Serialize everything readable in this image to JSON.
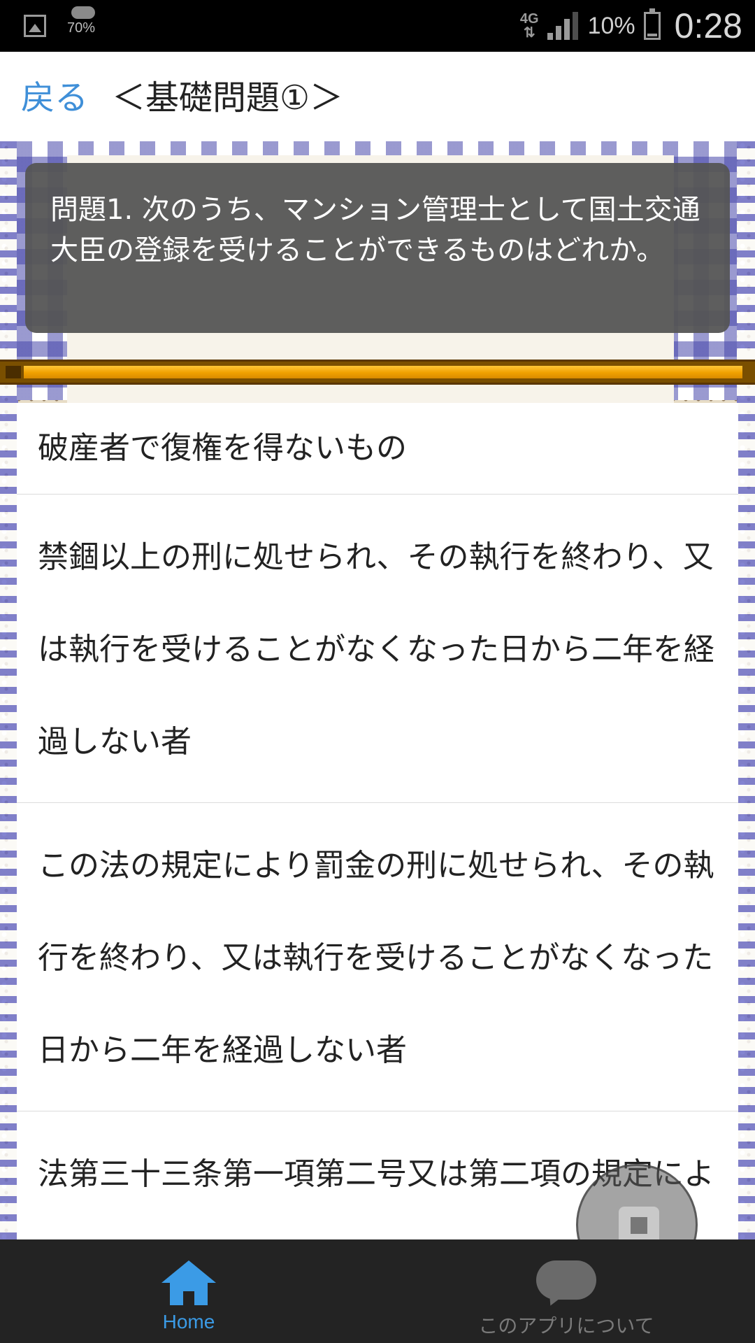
{
  "status_bar": {
    "humidity": "70%",
    "network": "4G",
    "battery": "10%",
    "time": "0:28",
    "icons": [
      "gallery-icon",
      "weather-icon",
      "network-icon",
      "signal-icon",
      "battery-icon"
    ]
  },
  "header": {
    "back_label": "戻る",
    "title": "＜基礎問題①＞"
  },
  "question": {
    "text": "問題1. 次のうち、マンション管理士として国土交通大臣の登録を受けることができるものはどれか。"
  },
  "progress": {
    "fraction": 0.99
  },
  "answers": [
    "破産者で復権を得ないもの",
    "禁錮以上の刑に処せられ、その執行を終わり、又は執行を受けることがなくなった日から二年を経過しない者",
    "この法の規定により罰金の刑に処せられ、その執行を終わり、又は執行を受けることがなくなった日から二年を経過しない者",
    "法第三十三条第一項第二号又は第二項の規定により登録を取り消され、その取消しの日か"
  ],
  "bottom_nav": {
    "home_label": "Home",
    "about_label": "このアプリについて",
    "active_color": "#3b9be6",
    "inactive_color": "#7a7a7a"
  },
  "colors": {
    "link": "#3f8fd8",
    "question_bg": "#555555",
    "progress_fill": "#f0a000"
  }
}
